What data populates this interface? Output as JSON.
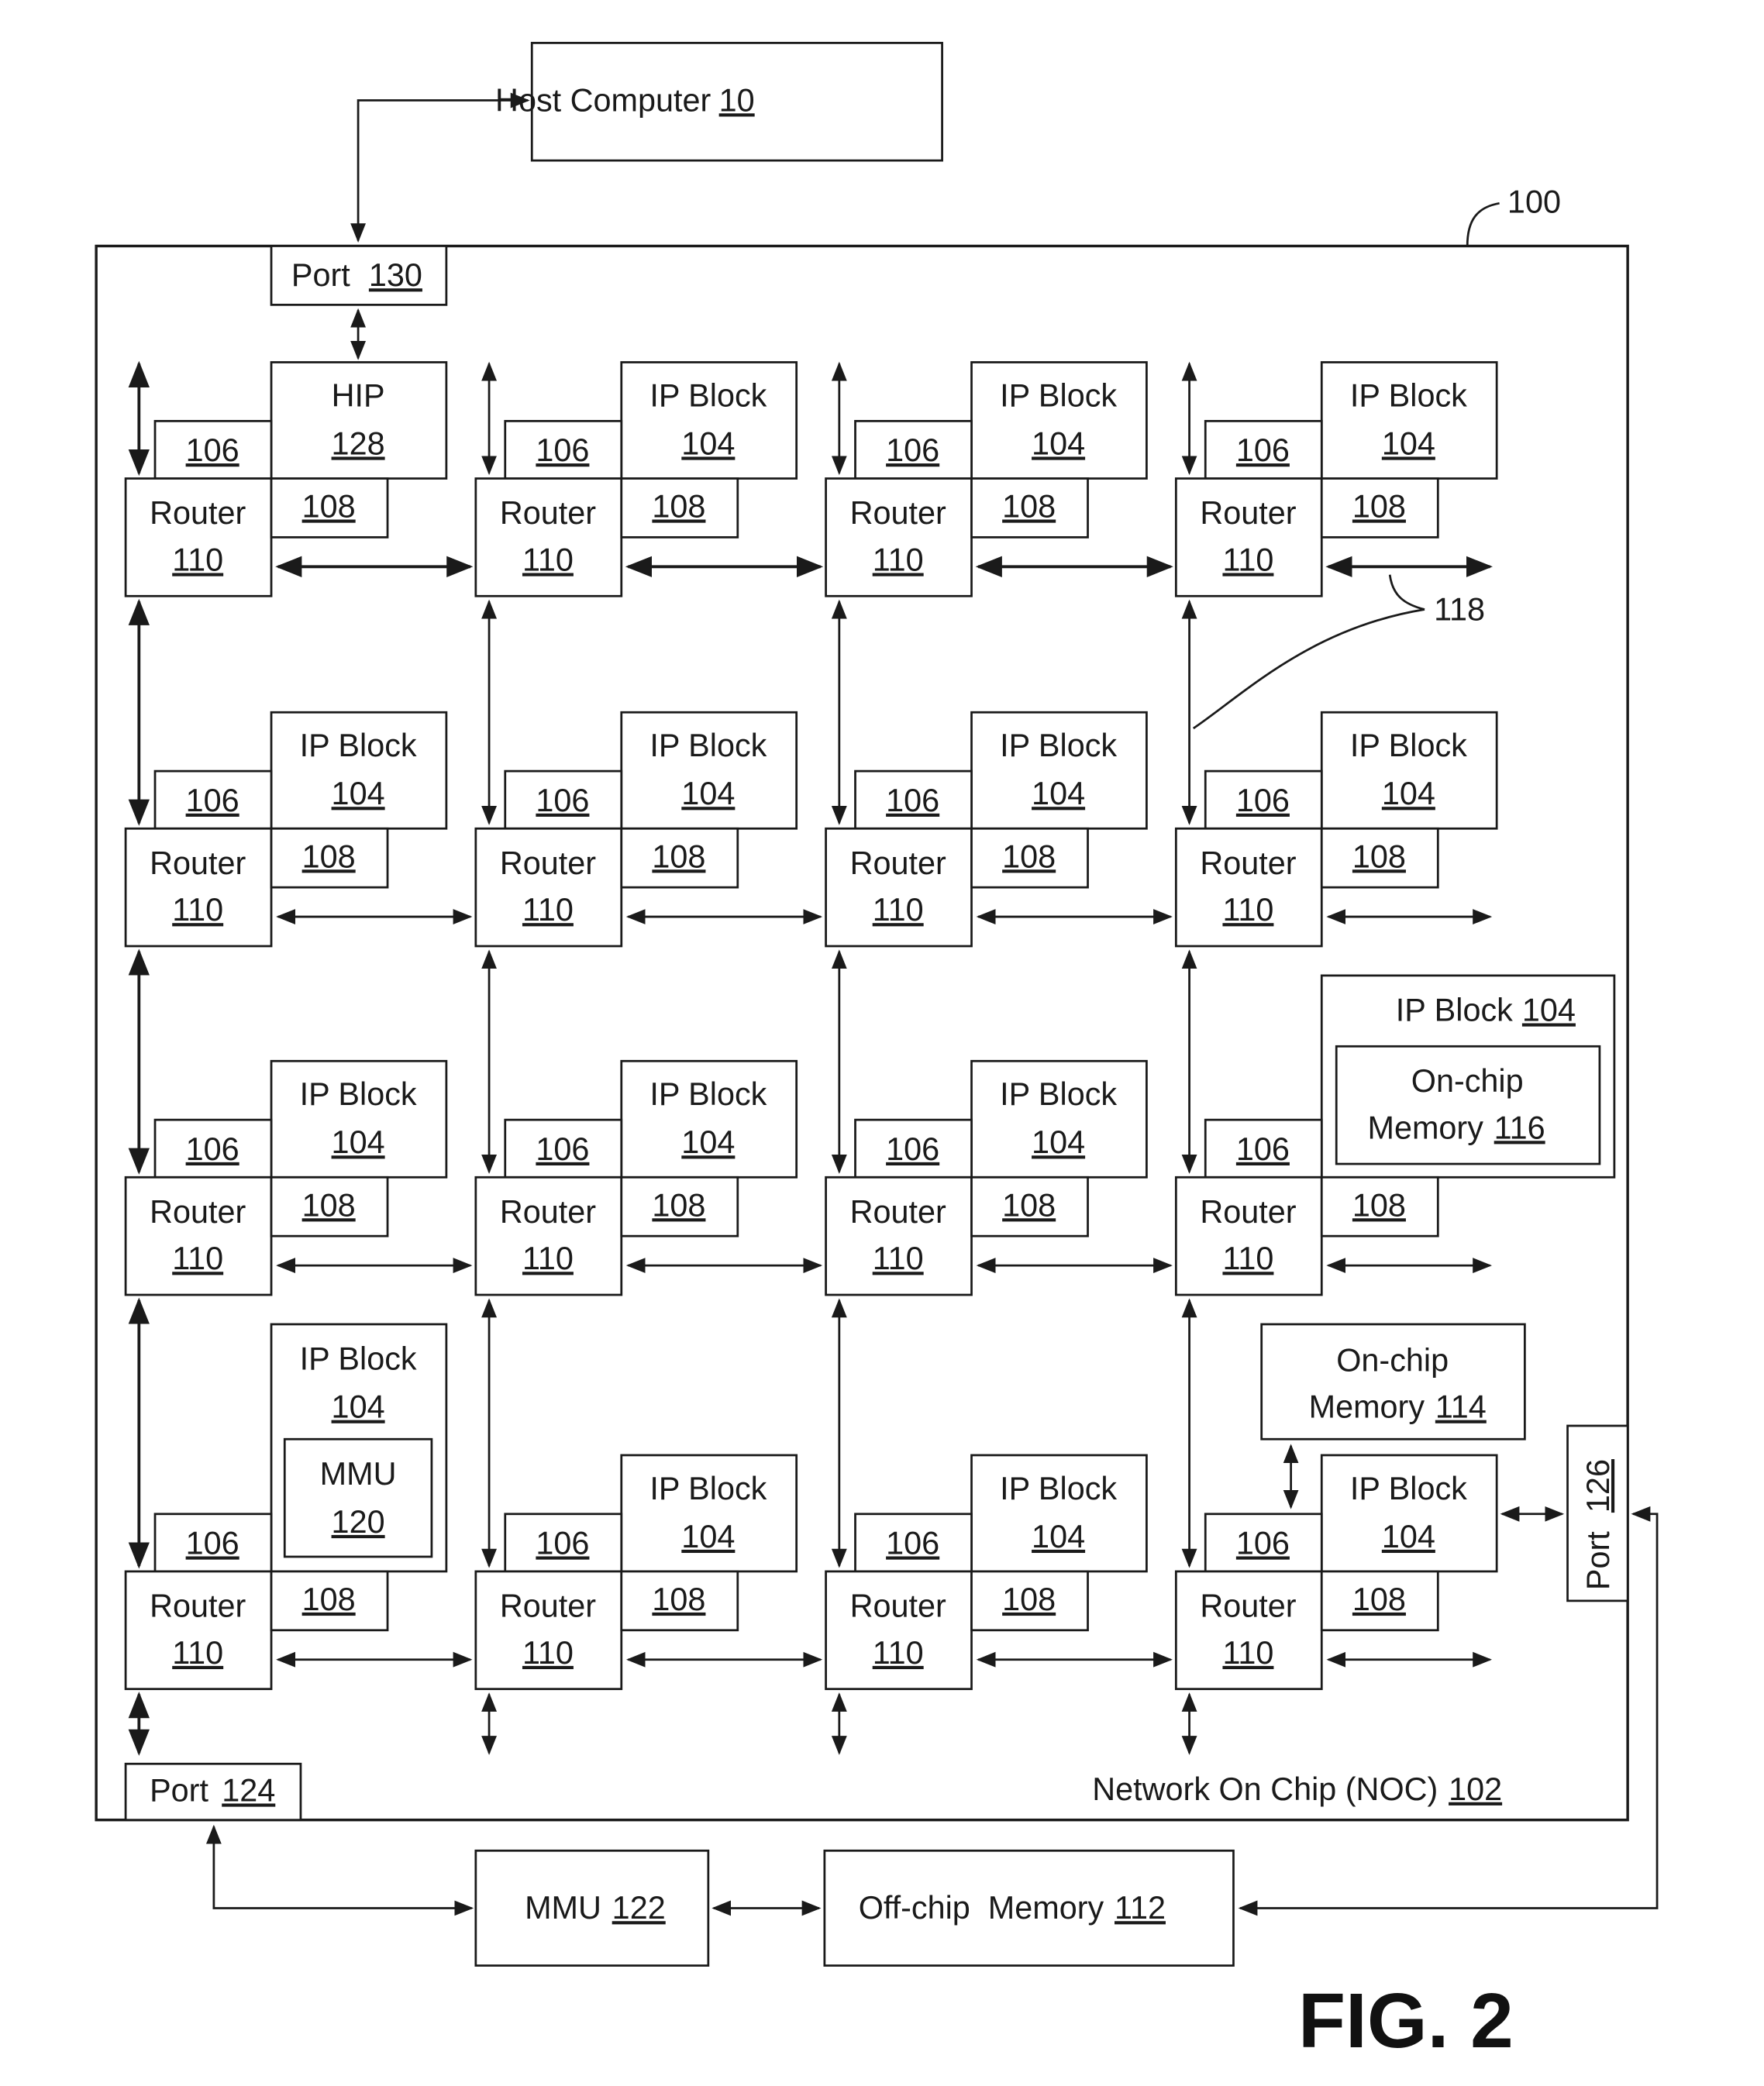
{
  "figure_label": "FIG. 2",
  "host": {
    "label": "Host Computer",
    "ref": "10"
  },
  "system_ref": "100",
  "noc": {
    "label": "Network On Chip (NOC)",
    "ref": "102"
  },
  "link_ref": "118",
  "ports": {
    "host_port": {
      "label": "Port",
      "ref": "130"
    },
    "memory_port": {
      "label": "Port",
      "ref": "124"
    },
    "io_port": {
      "label": "Port",
      "ref": "126"
    }
  },
  "component_labels": {
    "router": "Router",
    "router_ref": "110",
    "memory_comm_ref": "106",
    "network_iface_ref": "108",
    "ip_block": "IP Block",
    "ip_block_ref": "104"
  },
  "hip": {
    "label": "HIP",
    "ref": "128"
  },
  "mmu_inner": {
    "label": "MMU",
    "ref": "120"
  },
  "onchip_116": {
    "line1": "On-chip",
    "line2": "Memory",
    "ref": "116"
  },
  "onchip_114": {
    "line1": "On-chip",
    "line2": "Memory",
    "ref": "114"
  },
  "mmu_external": {
    "label": "MMU",
    "ref": "122"
  },
  "offchip": {
    "label": "Off-chip  Memory",
    "ref": "112"
  },
  "grid": {
    "rows": 4,
    "cols": 4,
    "special_cells": [
      {
        "row": 0,
        "col": 0,
        "block": "HIP 128"
      },
      {
        "row": 2,
        "col": 3,
        "block": "IP Block 104 with On-chip Memory 116"
      },
      {
        "row": 3,
        "col": 0,
        "block": "IP Block 104 with MMU 120"
      },
      {
        "row": 3,
        "col": 3,
        "block": "IP Block 104 linked to On-chip Memory 114 and Port 126"
      }
    ]
  }
}
